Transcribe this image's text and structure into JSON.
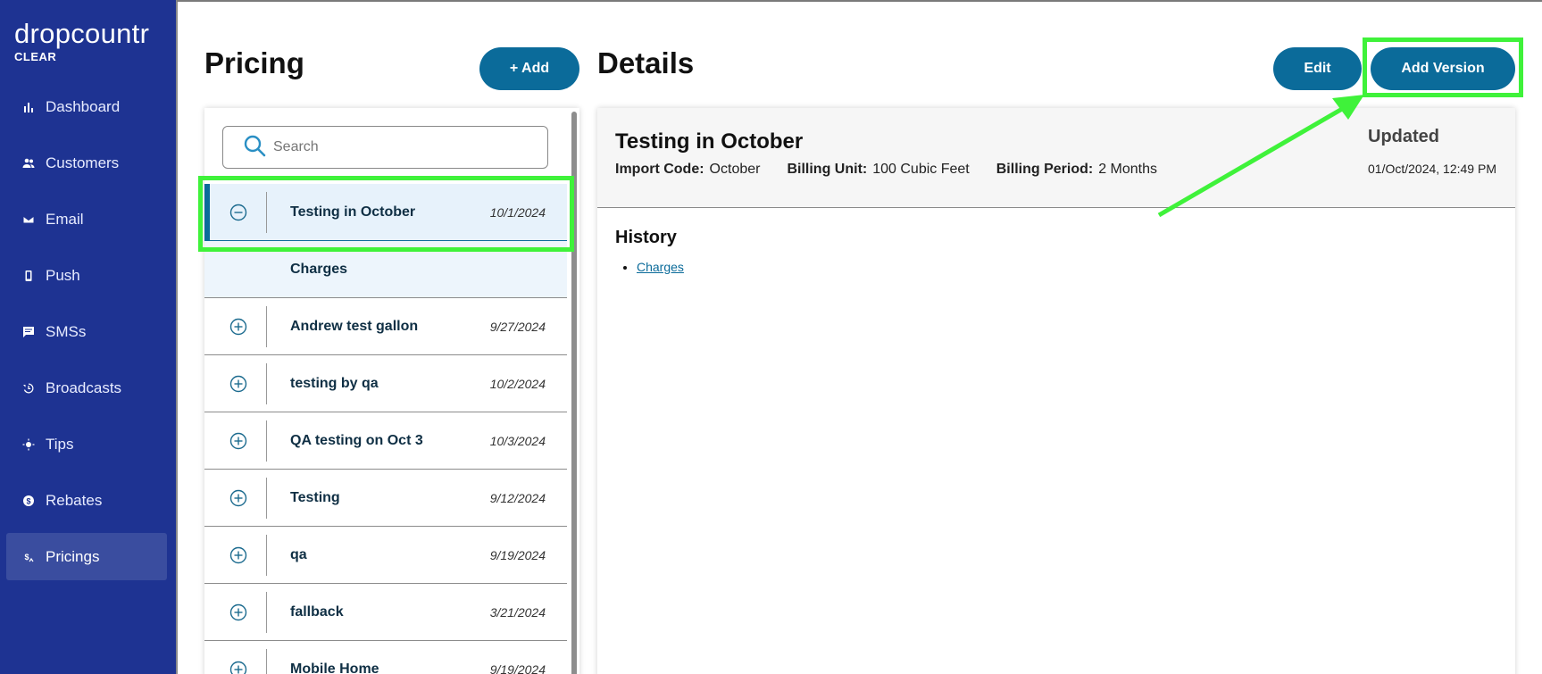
{
  "brand": {
    "name": "dropcountr",
    "sub": "CLEAR"
  },
  "nav": [
    {
      "label": "Dashboard",
      "icon": "bar-chart-icon"
    },
    {
      "label": "Customers",
      "icon": "people-icon"
    },
    {
      "label": "Email",
      "icon": "mail-icon"
    },
    {
      "label": "Push",
      "icon": "phone-icon"
    },
    {
      "label": "SMSs",
      "icon": "chat-icon"
    },
    {
      "label": "Broadcasts",
      "icon": "history-icon"
    },
    {
      "label": "Tips",
      "icon": "sun-icon"
    },
    {
      "label": "Rebates",
      "icon": "dollar-circle-icon"
    },
    {
      "label": "Pricings",
      "icon": "pricing-icon",
      "active": true
    }
  ],
  "pricing": {
    "title": "Pricing",
    "add_label": "+ Add",
    "search_placeholder": "Search",
    "rows": [
      {
        "name": "Testing in October",
        "date": "10/1/2024",
        "expanded": true,
        "sub": "Charges"
      },
      {
        "name": "Andrew test gallon",
        "date": "9/27/2024"
      },
      {
        "name": "testing by qa",
        "date": "10/2/2024"
      },
      {
        "name": "QA testing on Oct 3",
        "date": "10/3/2024"
      },
      {
        "name": "Testing",
        "date": "9/12/2024"
      },
      {
        "name": "qa",
        "date": "9/19/2024"
      },
      {
        "name": "fallback",
        "date": "3/21/2024"
      },
      {
        "name": "Mobile Home",
        "date": "9/19/2024"
      }
    ]
  },
  "details": {
    "title": "Details",
    "edit_label": "Edit",
    "add_version_label": "Add Version",
    "name": "Testing in October",
    "import_code_label": "Import Code:",
    "import_code": "October",
    "billing_unit_label": "Billing Unit:",
    "billing_unit": "100 Cubic Feet",
    "billing_period_label": "Billing Period:",
    "billing_period": "2 Months",
    "updated_label": "Updated",
    "updated_value": "01/Oct/2024, 12:49 PM",
    "history_title": "History",
    "history_items": [
      "Charges"
    ]
  },
  "colors": {
    "sidebar": "#1e3392",
    "accent": "#0b6b9a",
    "highlight": "#3ff23a"
  }
}
